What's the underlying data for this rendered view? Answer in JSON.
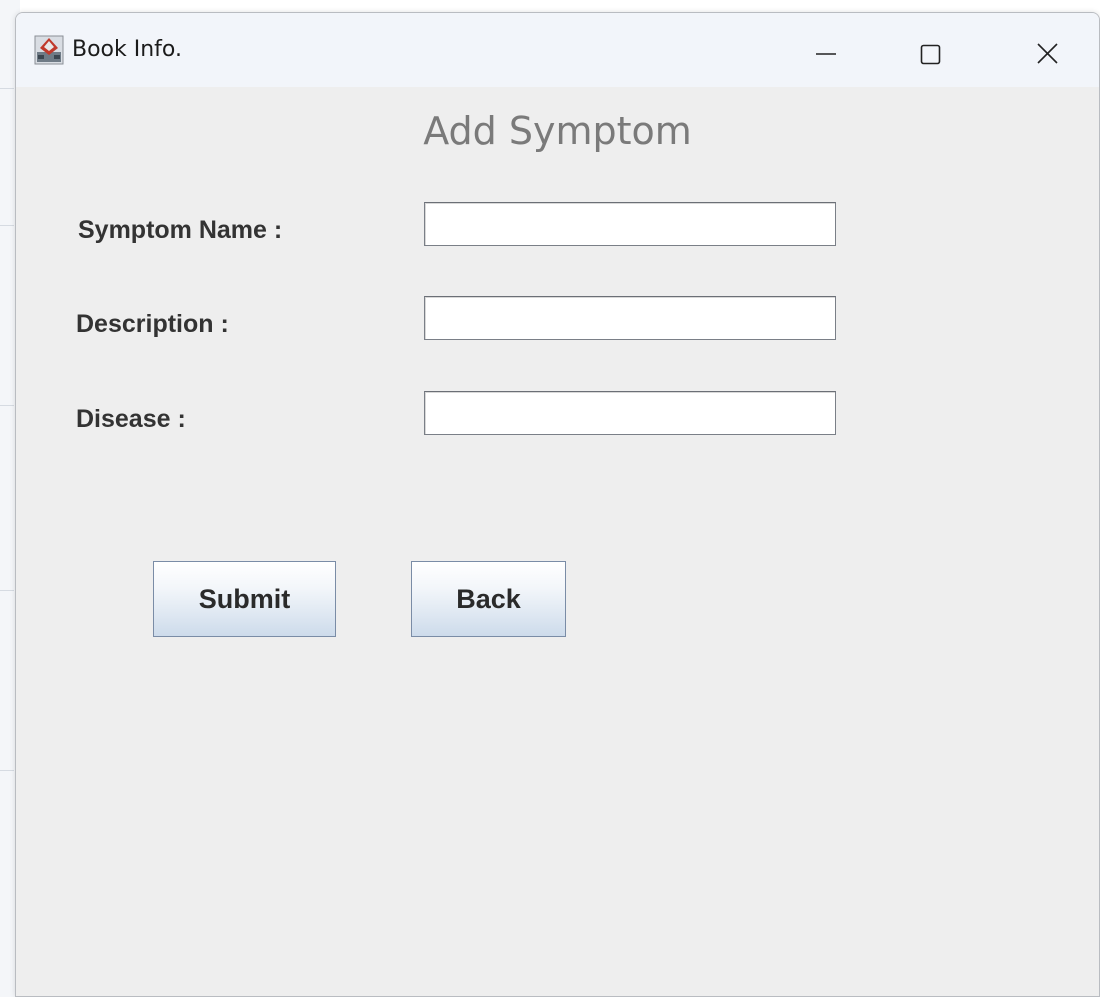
{
  "window": {
    "title": "Book Info.",
    "controls": {
      "minimize_icon": "minimize-icon",
      "maximize_icon": "maximize-icon",
      "close_icon": "close-icon"
    }
  },
  "form": {
    "heading": "Add Symptom",
    "fields": [
      {
        "label": "Symptom Name :",
        "value": "",
        "placeholder": ""
      },
      {
        "label": "Description :",
        "value": "",
        "placeholder": ""
      },
      {
        "label": "Disease :",
        "value": "",
        "placeholder": ""
      }
    ],
    "buttons": {
      "submit_label": "Submit",
      "back_label": "Back"
    }
  },
  "colors": {
    "window_bg": "#eeeeee",
    "titlebar_bg": "#f2f5fa",
    "heading_text": "#7a7a7a",
    "label_text": "#333333",
    "button_gradient_top": "#ffffff",
    "button_gradient_bottom": "#cddbeb",
    "button_border": "#7a8ca6"
  }
}
